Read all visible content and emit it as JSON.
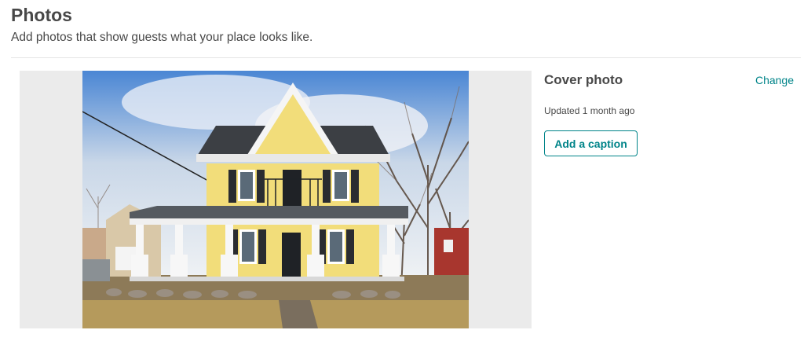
{
  "header": {
    "title": "Photos",
    "subtitle": "Add photos that show guests what your place looks like."
  },
  "cover": {
    "title": "Cover photo",
    "change_label": "Change",
    "updated_text": "Updated 1 month ago",
    "caption_button_label": "Add a caption"
  },
  "colors": {
    "accent": "#008489",
    "text": "#484848",
    "frame_background": "#ebebeb",
    "divider": "#e4e4e4"
  },
  "photo": {
    "subject": "yellow-victorian-house"
  }
}
